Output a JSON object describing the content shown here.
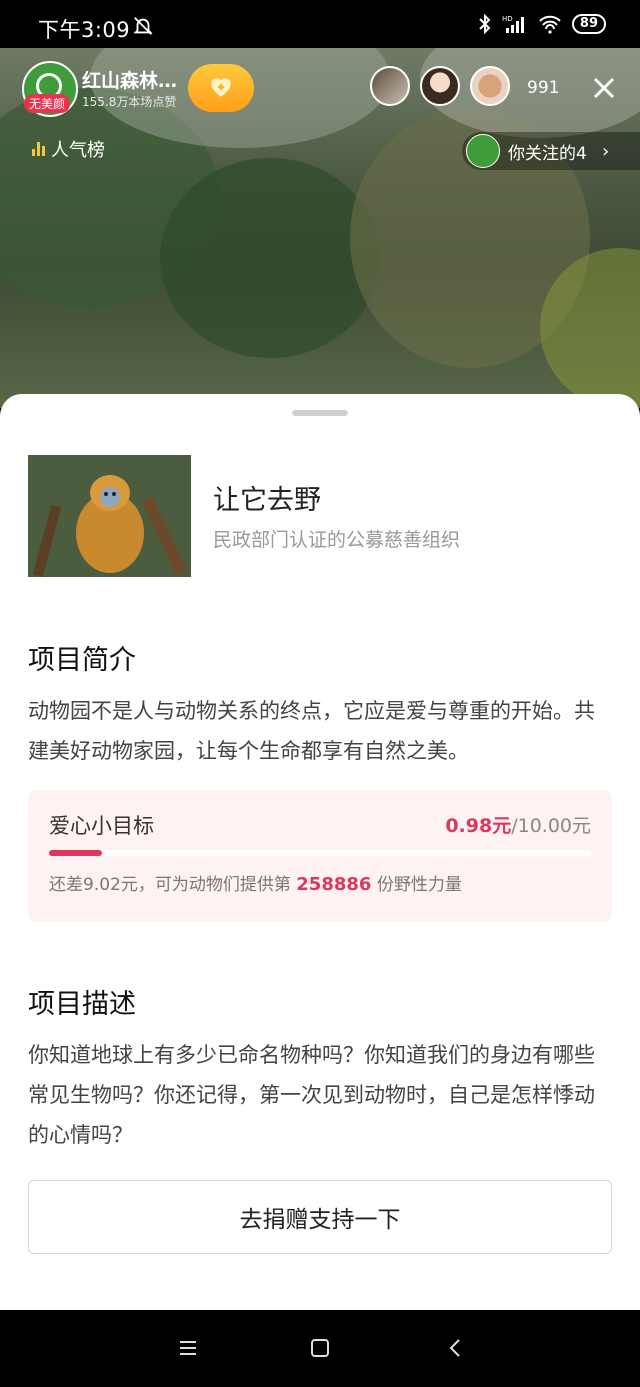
{
  "status_bar": {
    "time": "下午3:09",
    "hd": "HD",
    "battery": "89"
  },
  "live": {
    "host_name": "红山森林…",
    "host_tag": "无美颜",
    "likes": "155.8万本场点赞",
    "viewer_count": "991",
    "rank_label": "人气榜",
    "follow_text": "你关注的4"
  },
  "sheet": {
    "org": {
      "name": "让它去野",
      "subtitle": "民政部门认证的公募慈善组织"
    },
    "intro": {
      "title": "项目简介",
      "text": "动物园不是人与动物关系的终点，它应是爱与尊重的开始。共建美好动物家园，让每个生命都享有自然之美。"
    },
    "goal": {
      "label": "爱心小目标",
      "current": "0.98元",
      "target": "/10.00元",
      "progress_fraction": 0.098,
      "note_prefix": "还差9.02元，可为动物们提供第",
      "note_number": "258886",
      "note_suffix": "份野性力量"
    },
    "desc": {
      "title": "项目描述",
      "text": "你知道地球上有多少已命名物种吗？你知道我们的身边有哪些常见生物吗？你还记得，第一次见到动物时，自己是怎样悸动的心情吗？"
    },
    "donate_button": "去捐赠支持一下"
  },
  "colors": {
    "accent": "#e0365a",
    "host_green": "#3e9c3a"
  }
}
